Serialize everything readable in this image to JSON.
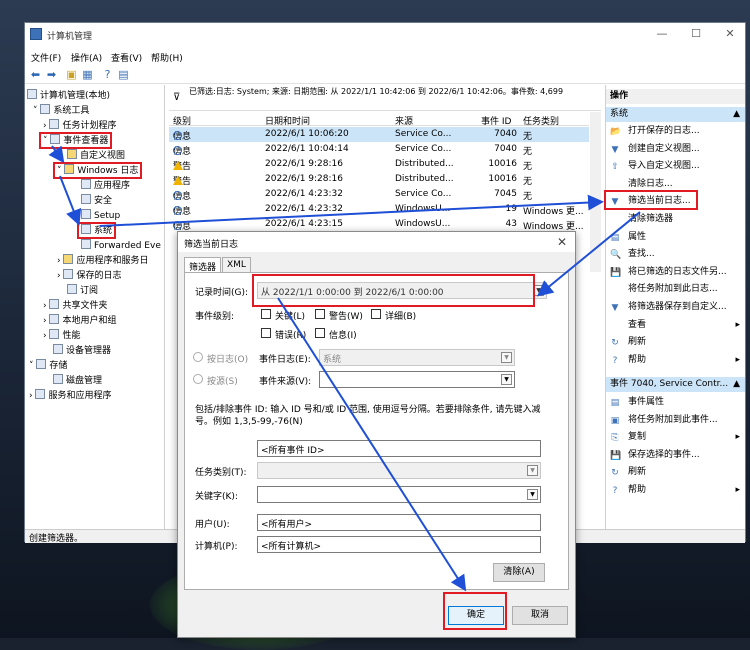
{
  "window": {
    "title": "计算机管理",
    "menu": [
      "文件(F)",
      "操作(A)",
      "查看(V)",
      "帮助(H)"
    ]
  },
  "tree": {
    "root": "计算机管理(本地)",
    "system_tools": "系统工具",
    "task_scheduler": "任务计划程序",
    "event_viewer": "事件查看器",
    "custom_views": "自定义视图",
    "windows_logs": "Windows 日志",
    "application": "应用程序",
    "security": "安全",
    "setup": "Setup",
    "system": "系统",
    "forwarded": "Forwarded Eve",
    "apps_services": "应用程序和服务日",
    "saved_logs": "保存的日志",
    "subscriptions": "订阅",
    "shared_folders": "共享文件夹",
    "local_users": "本地用户和组",
    "performance": "性能",
    "device_manager": "设备管理器",
    "storage": "存储",
    "disk_mgmt": "磁盘管理",
    "services_apps": "服务和应用程序"
  },
  "events": {
    "filter_text": "已筛选:日志: System; 来源: 日期范围: 从 2022/1/1 10:42:06 到 2022/6/1 10:42:06。事件数: 4,699",
    "columns": [
      "级别",
      "日期和时间",
      "来源",
      "事件 ID",
      "任务类别"
    ],
    "rows": [
      {
        "level": "信息",
        "type": "info",
        "datetime": "2022/6/1 10:06:20",
        "source": "Service Co...",
        "id": "7040",
        "task": "无"
      },
      {
        "level": "信息",
        "type": "info",
        "datetime": "2022/6/1 10:04:14",
        "source": "Service Co...",
        "id": "7040",
        "task": "无"
      },
      {
        "level": "警告",
        "type": "warn",
        "datetime": "2022/6/1 9:28:16",
        "source": "Distributed...",
        "id": "10016",
        "task": "无"
      },
      {
        "level": "警告",
        "type": "warn",
        "datetime": "2022/6/1 9:28:16",
        "source": "Distributed...",
        "id": "10016",
        "task": "无"
      },
      {
        "level": "信息",
        "type": "info",
        "datetime": "2022/6/1 4:23:32",
        "source": "Service Co...",
        "id": "7045",
        "task": "无"
      },
      {
        "level": "信息",
        "type": "info",
        "datetime": "2022/6/1 4:23:32",
        "source": "WindowsU...",
        "id": "19",
        "task": "Windows 更..."
      },
      {
        "level": "信息",
        "type": "info",
        "datetime": "2022/6/1 4:23:15",
        "source": "WindowsU...",
        "id": "43",
        "task": "Windows 更..."
      }
    ]
  },
  "actions": {
    "header": "操作",
    "section1": "系统",
    "items1": [
      "打开保存的日志...",
      "创建自定义视图...",
      "导入自定义视图...",
      "清除日志...",
      "筛选当前日志...",
      "清除筛选器",
      "属性",
      "查找...",
      "将已筛选的日志文件另...",
      "将任务附加到此日志...",
      "将筛选器保存到自定义...",
      "查看",
      "刷新",
      "帮助"
    ],
    "section2": "事件 7040, Service Contr...",
    "items2": [
      "事件属性",
      "将任务附加到此事件...",
      "复制",
      "保存选择的事件...",
      "刷新",
      "帮助"
    ]
  },
  "status": "创建筛选器。",
  "dialog": {
    "title": "筛选当前日志",
    "tabs": [
      "筛选器",
      "XML"
    ],
    "logged_label": "记录时间(G):",
    "logged_value": "从 2022/1/1 0:00:00 到 2022/6/1 0:00:00",
    "level_label": "事件级别:",
    "levels": [
      "关键(L)",
      "警告(W)",
      "详细(B)",
      "错误(R)",
      "信息(I)"
    ],
    "by_log": "按日志(O)",
    "log_label": "事件日志(E):",
    "log_value": "系统",
    "by_source": "按源(S)",
    "source_label": "事件来源(V):",
    "include_text": "包括/排除事件 ID: 输入 ID 号和/或 ID 范围, 使用逗号分隔。若要排除条件, 请先键入减号。例如 1,3,5-99,-76(N)",
    "id_value": "<所有事件 ID>",
    "task_label": "任务类别(T):",
    "keywords_label": "关键字(K):",
    "user_label": "用户(U):",
    "user_value": "<所有用户>",
    "computer_label": "计算机(P):",
    "computer_value": "<所有计算机>",
    "clear_btn": "清除(A)",
    "ok_btn": "确定",
    "cancel_btn": "取消"
  }
}
